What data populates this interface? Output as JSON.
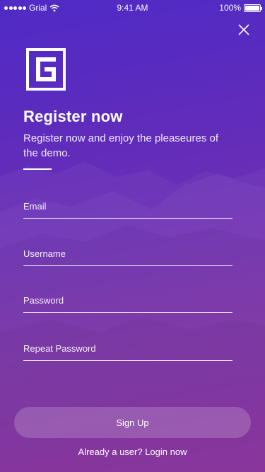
{
  "status_bar": {
    "carrier": "Grial",
    "time": "9:41 AM",
    "battery": "100%",
    "battery_level": 1.0
  },
  "icons": {
    "close": "close-icon",
    "logo": "grial-logo-icon",
    "wifi": "wifi-icon",
    "signal": "signal-icon",
    "battery": "battery-icon"
  },
  "header": {
    "title": "Register now",
    "subtitle": "Register now and enjoy the pleaseures of the demo."
  },
  "form": {
    "email_placeholder": "Email",
    "username_placeholder": "Username",
    "password_placeholder": "Password",
    "repeat_password_placeholder": "Repeat Password"
  },
  "actions": {
    "signup_label": "Sign Up",
    "login_link": "Already a user? Login now"
  },
  "colors": {
    "gradient_top": "#4f2bc6",
    "gradient_bottom": "#8e2a9e",
    "text": "#ffffff"
  }
}
